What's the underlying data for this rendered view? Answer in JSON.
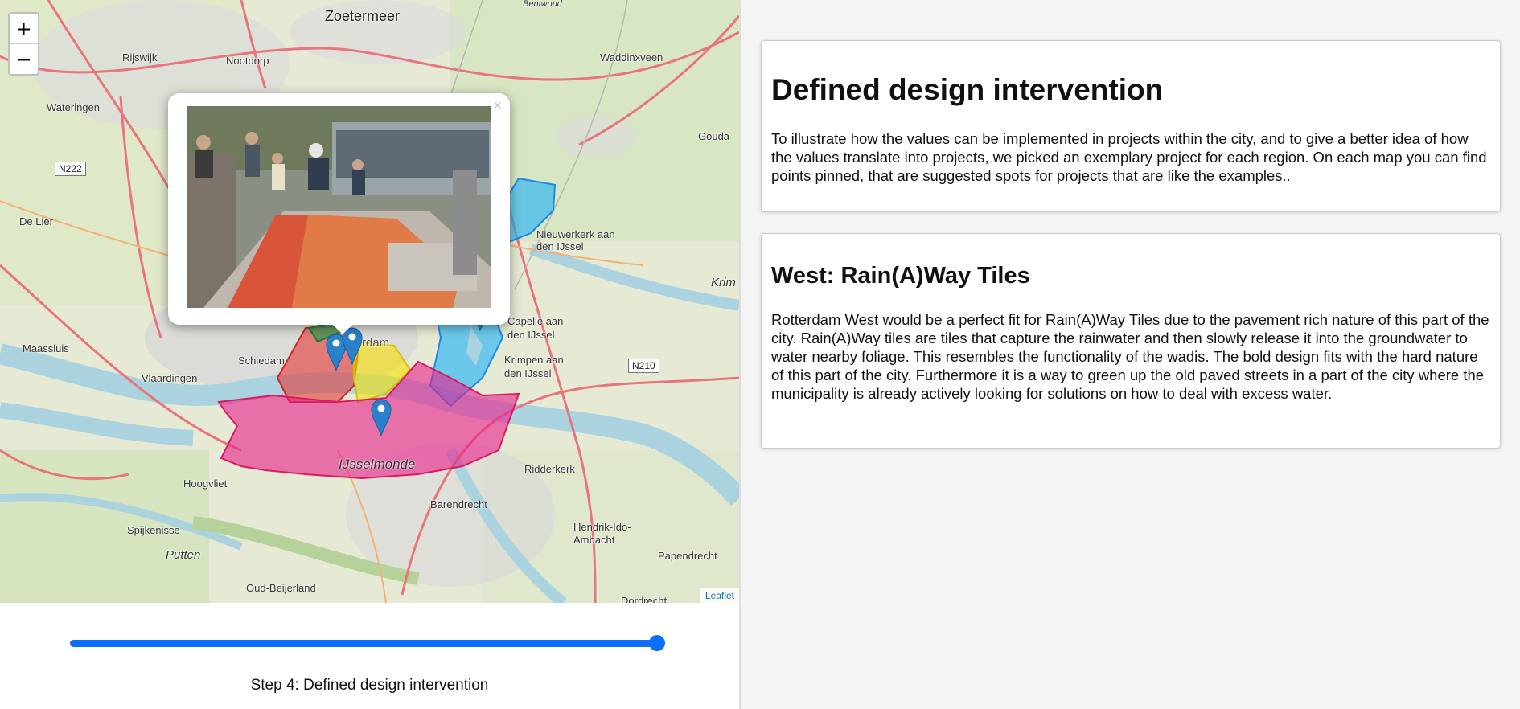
{
  "map": {
    "zoom_in": "+",
    "zoom_out": "−",
    "attribution": "Leaflet",
    "popup_close": "×",
    "places": [
      {
        "name": "Zoetermeer",
        "cls": "big"
      },
      {
        "name": "Rijswijk",
        "cls": ""
      },
      {
        "name": "Nootdorp",
        "cls": ""
      },
      {
        "name": "Waddinxveen",
        "cls": ""
      },
      {
        "name": "Wateringen",
        "cls": ""
      },
      {
        "name": "Gouda",
        "cls": ""
      },
      {
        "name": "De Lier",
        "cls": ""
      },
      {
        "name": "Nieuwerkerk aan den IJssel",
        "cls": ""
      },
      {
        "name": "Krim",
        "cls": "it"
      },
      {
        "name": "Maassluis",
        "cls": ""
      },
      {
        "name": "Schiedam",
        "cls": ""
      },
      {
        "name": "Vlaardingen",
        "cls": ""
      },
      {
        "name": "Capelle aan den IJssel",
        "cls": ""
      },
      {
        "name": "Krimpen aan den IJssel",
        "cls": ""
      },
      {
        "name": "IJsselmonde",
        "cls": "it"
      },
      {
        "name": "Hoogvliet",
        "cls": ""
      },
      {
        "name": "Ridderkerk",
        "cls": ""
      },
      {
        "name": "Barendrecht",
        "cls": ""
      },
      {
        "name": "Spijkenisse",
        "cls": ""
      },
      {
        "name": "Putten",
        "cls": "it"
      },
      {
        "name": "Hendrik-Ido-Ambacht",
        "cls": ""
      },
      {
        "name": "Papendrecht",
        "cls": ""
      },
      {
        "name": "Oud-Beijerland",
        "cls": ""
      },
      {
        "name": "Dordrecht",
        "cls": ""
      },
      {
        "name": "Bentwoud",
        "cls": "it"
      },
      {
        "name": "rdam",
        "cls": ""
      }
    ],
    "shields": [
      "N222",
      "N210"
    ]
  },
  "slider": {
    "value_fraction": 1.0
  },
  "step_label": "Step 4: Defined design intervention",
  "intro": {
    "title": "Defined design intervention",
    "body": "To illustrate how the values can be implemented in projects within the city, and to give a better idea of how the values translate into projects, we picked an exemplary project for each region. On each map you can find points pinned, that are suggested spots for projects that are like the examples.."
  },
  "region": {
    "title": "West: Rain(A)Way Tiles",
    "body": "Rotterdam West would be a perfect fit for Rain(A)Way Tiles due to the pavement rich nature of this part of the city. Rain(A)Way tiles are tiles that capture the rainwater and then slowly release it into the groundwater to water nearby foliage. This resembles the functionality of the wadis. The bold design fits with the hard nature of this part of the city. Furthermore it is a way to green up the old paved streets in a part of the city where the municipality is already actively looking for solutions on how to deal with excess water."
  },
  "colors": {
    "slider": "#0d6efd",
    "region_west": "#e53935",
    "region_south": "#e91e8c",
    "region_center": "#f5e000",
    "region_north": "#2e9e4f",
    "region_east": "#29b6f6",
    "marker": "#2a81cb"
  }
}
